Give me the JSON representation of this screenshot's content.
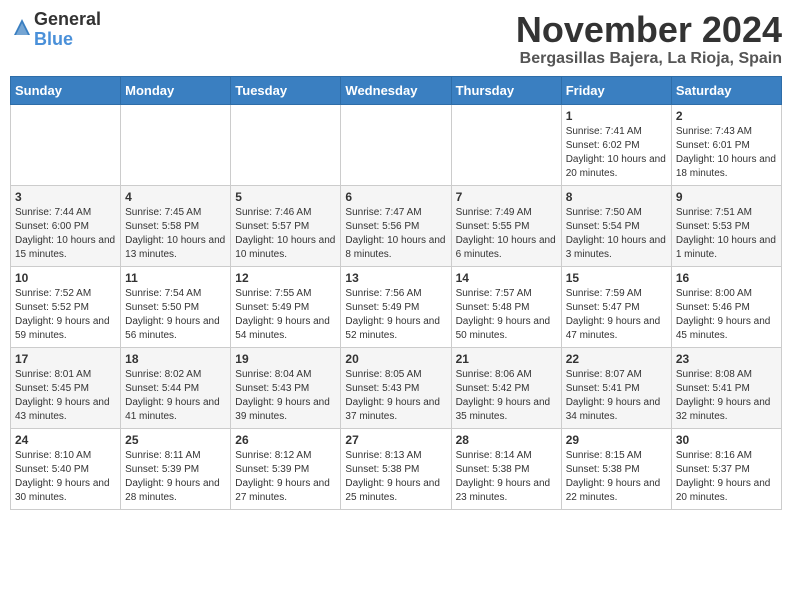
{
  "logo": {
    "general": "General",
    "blue": "Blue"
  },
  "header": {
    "month": "November 2024",
    "location": "Bergasillas Bajera, La Rioja, Spain"
  },
  "weekdays": [
    "Sunday",
    "Monday",
    "Tuesday",
    "Wednesday",
    "Thursday",
    "Friday",
    "Saturday"
  ],
  "weeks": [
    [
      {
        "day": "",
        "info": ""
      },
      {
        "day": "",
        "info": ""
      },
      {
        "day": "",
        "info": ""
      },
      {
        "day": "",
        "info": ""
      },
      {
        "day": "",
        "info": ""
      },
      {
        "day": "1",
        "info": "Sunrise: 7:41 AM\nSunset: 6:02 PM\nDaylight: 10 hours and 20 minutes."
      },
      {
        "day": "2",
        "info": "Sunrise: 7:43 AM\nSunset: 6:01 PM\nDaylight: 10 hours and 18 minutes."
      }
    ],
    [
      {
        "day": "3",
        "info": "Sunrise: 7:44 AM\nSunset: 6:00 PM\nDaylight: 10 hours and 15 minutes."
      },
      {
        "day": "4",
        "info": "Sunrise: 7:45 AM\nSunset: 5:58 PM\nDaylight: 10 hours and 13 minutes."
      },
      {
        "day": "5",
        "info": "Sunrise: 7:46 AM\nSunset: 5:57 PM\nDaylight: 10 hours and 10 minutes."
      },
      {
        "day": "6",
        "info": "Sunrise: 7:47 AM\nSunset: 5:56 PM\nDaylight: 10 hours and 8 minutes."
      },
      {
        "day": "7",
        "info": "Sunrise: 7:49 AM\nSunset: 5:55 PM\nDaylight: 10 hours and 6 minutes."
      },
      {
        "day": "8",
        "info": "Sunrise: 7:50 AM\nSunset: 5:54 PM\nDaylight: 10 hours and 3 minutes."
      },
      {
        "day": "9",
        "info": "Sunrise: 7:51 AM\nSunset: 5:53 PM\nDaylight: 10 hours and 1 minute."
      }
    ],
    [
      {
        "day": "10",
        "info": "Sunrise: 7:52 AM\nSunset: 5:52 PM\nDaylight: 9 hours and 59 minutes."
      },
      {
        "day": "11",
        "info": "Sunrise: 7:54 AM\nSunset: 5:50 PM\nDaylight: 9 hours and 56 minutes."
      },
      {
        "day": "12",
        "info": "Sunrise: 7:55 AM\nSunset: 5:49 PM\nDaylight: 9 hours and 54 minutes."
      },
      {
        "day": "13",
        "info": "Sunrise: 7:56 AM\nSunset: 5:49 PM\nDaylight: 9 hours and 52 minutes."
      },
      {
        "day": "14",
        "info": "Sunrise: 7:57 AM\nSunset: 5:48 PM\nDaylight: 9 hours and 50 minutes."
      },
      {
        "day": "15",
        "info": "Sunrise: 7:59 AM\nSunset: 5:47 PM\nDaylight: 9 hours and 47 minutes."
      },
      {
        "day": "16",
        "info": "Sunrise: 8:00 AM\nSunset: 5:46 PM\nDaylight: 9 hours and 45 minutes."
      }
    ],
    [
      {
        "day": "17",
        "info": "Sunrise: 8:01 AM\nSunset: 5:45 PM\nDaylight: 9 hours and 43 minutes."
      },
      {
        "day": "18",
        "info": "Sunrise: 8:02 AM\nSunset: 5:44 PM\nDaylight: 9 hours and 41 minutes."
      },
      {
        "day": "19",
        "info": "Sunrise: 8:04 AM\nSunset: 5:43 PM\nDaylight: 9 hours and 39 minutes."
      },
      {
        "day": "20",
        "info": "Sunrise: 8:05 AM\nSunset: 5:43 PM\nDaylight: 9 hours and 37 minutes."
      },
      {
        "day": "21",
        "info": "Sunrise: 8:06 AM\nSunset: 5:42 PM\nDaylight: 9 hours and 35 minutes."
      },
      {
        "day": "22",
        "info": "Sunrise: 8:07 AM\nSunset: 5:41 PM\nDaylight: 9 hours and 34 minutes."
      },
      {
        "day": "23",
        "info": "Sunrise: 8:08 AM\nSunset: 5:41 PM\nDaylight: 9 hours and 32 minutes."
      }
    ],
    [
      {
        "day": "24",
        "info": "Sunrise: 8:10 AM\nSunset: 5:40 PM\nDaylight: 9 hours and 30 minutes."
      },
      {
        "day": "25",
        "info": "Sunrise: 8:11 AM\nSunset: 5:39 PM\nDaylight: 9 hours and 28 minutes."
      },
      {
        "day": "26",
        "info": "Sunrise: 8:12 AM\nSunset: 5:39 PM\nDaylight: 9 hours and 27 minutes."
      },
      {
        "day": "27",
        "info": "Sunrise: 8:13 AM\nSunset: 5:38 PM\nDaylight: 9 hours and 25 minutes."
      },
      {
        "day": "28",
        "info": "Sunrise: 8:14 AM\nSunset: 5:38 PM\nDaylight: 9 hours and 23 minutes."
      },
      {
        "day": "29",
        "info": "Sunrise: 8:15 AM\nSunset: 5:38 PM\nDaylight: 9 hours and 22 minutes."
      },
      {
        "day": "30",
        "info": "Sunrise: 8:16 AM\nSunset: 5:37 PM\nDaylight: 9 hours and 20 minutes."
      }
    ]
  ]
}
